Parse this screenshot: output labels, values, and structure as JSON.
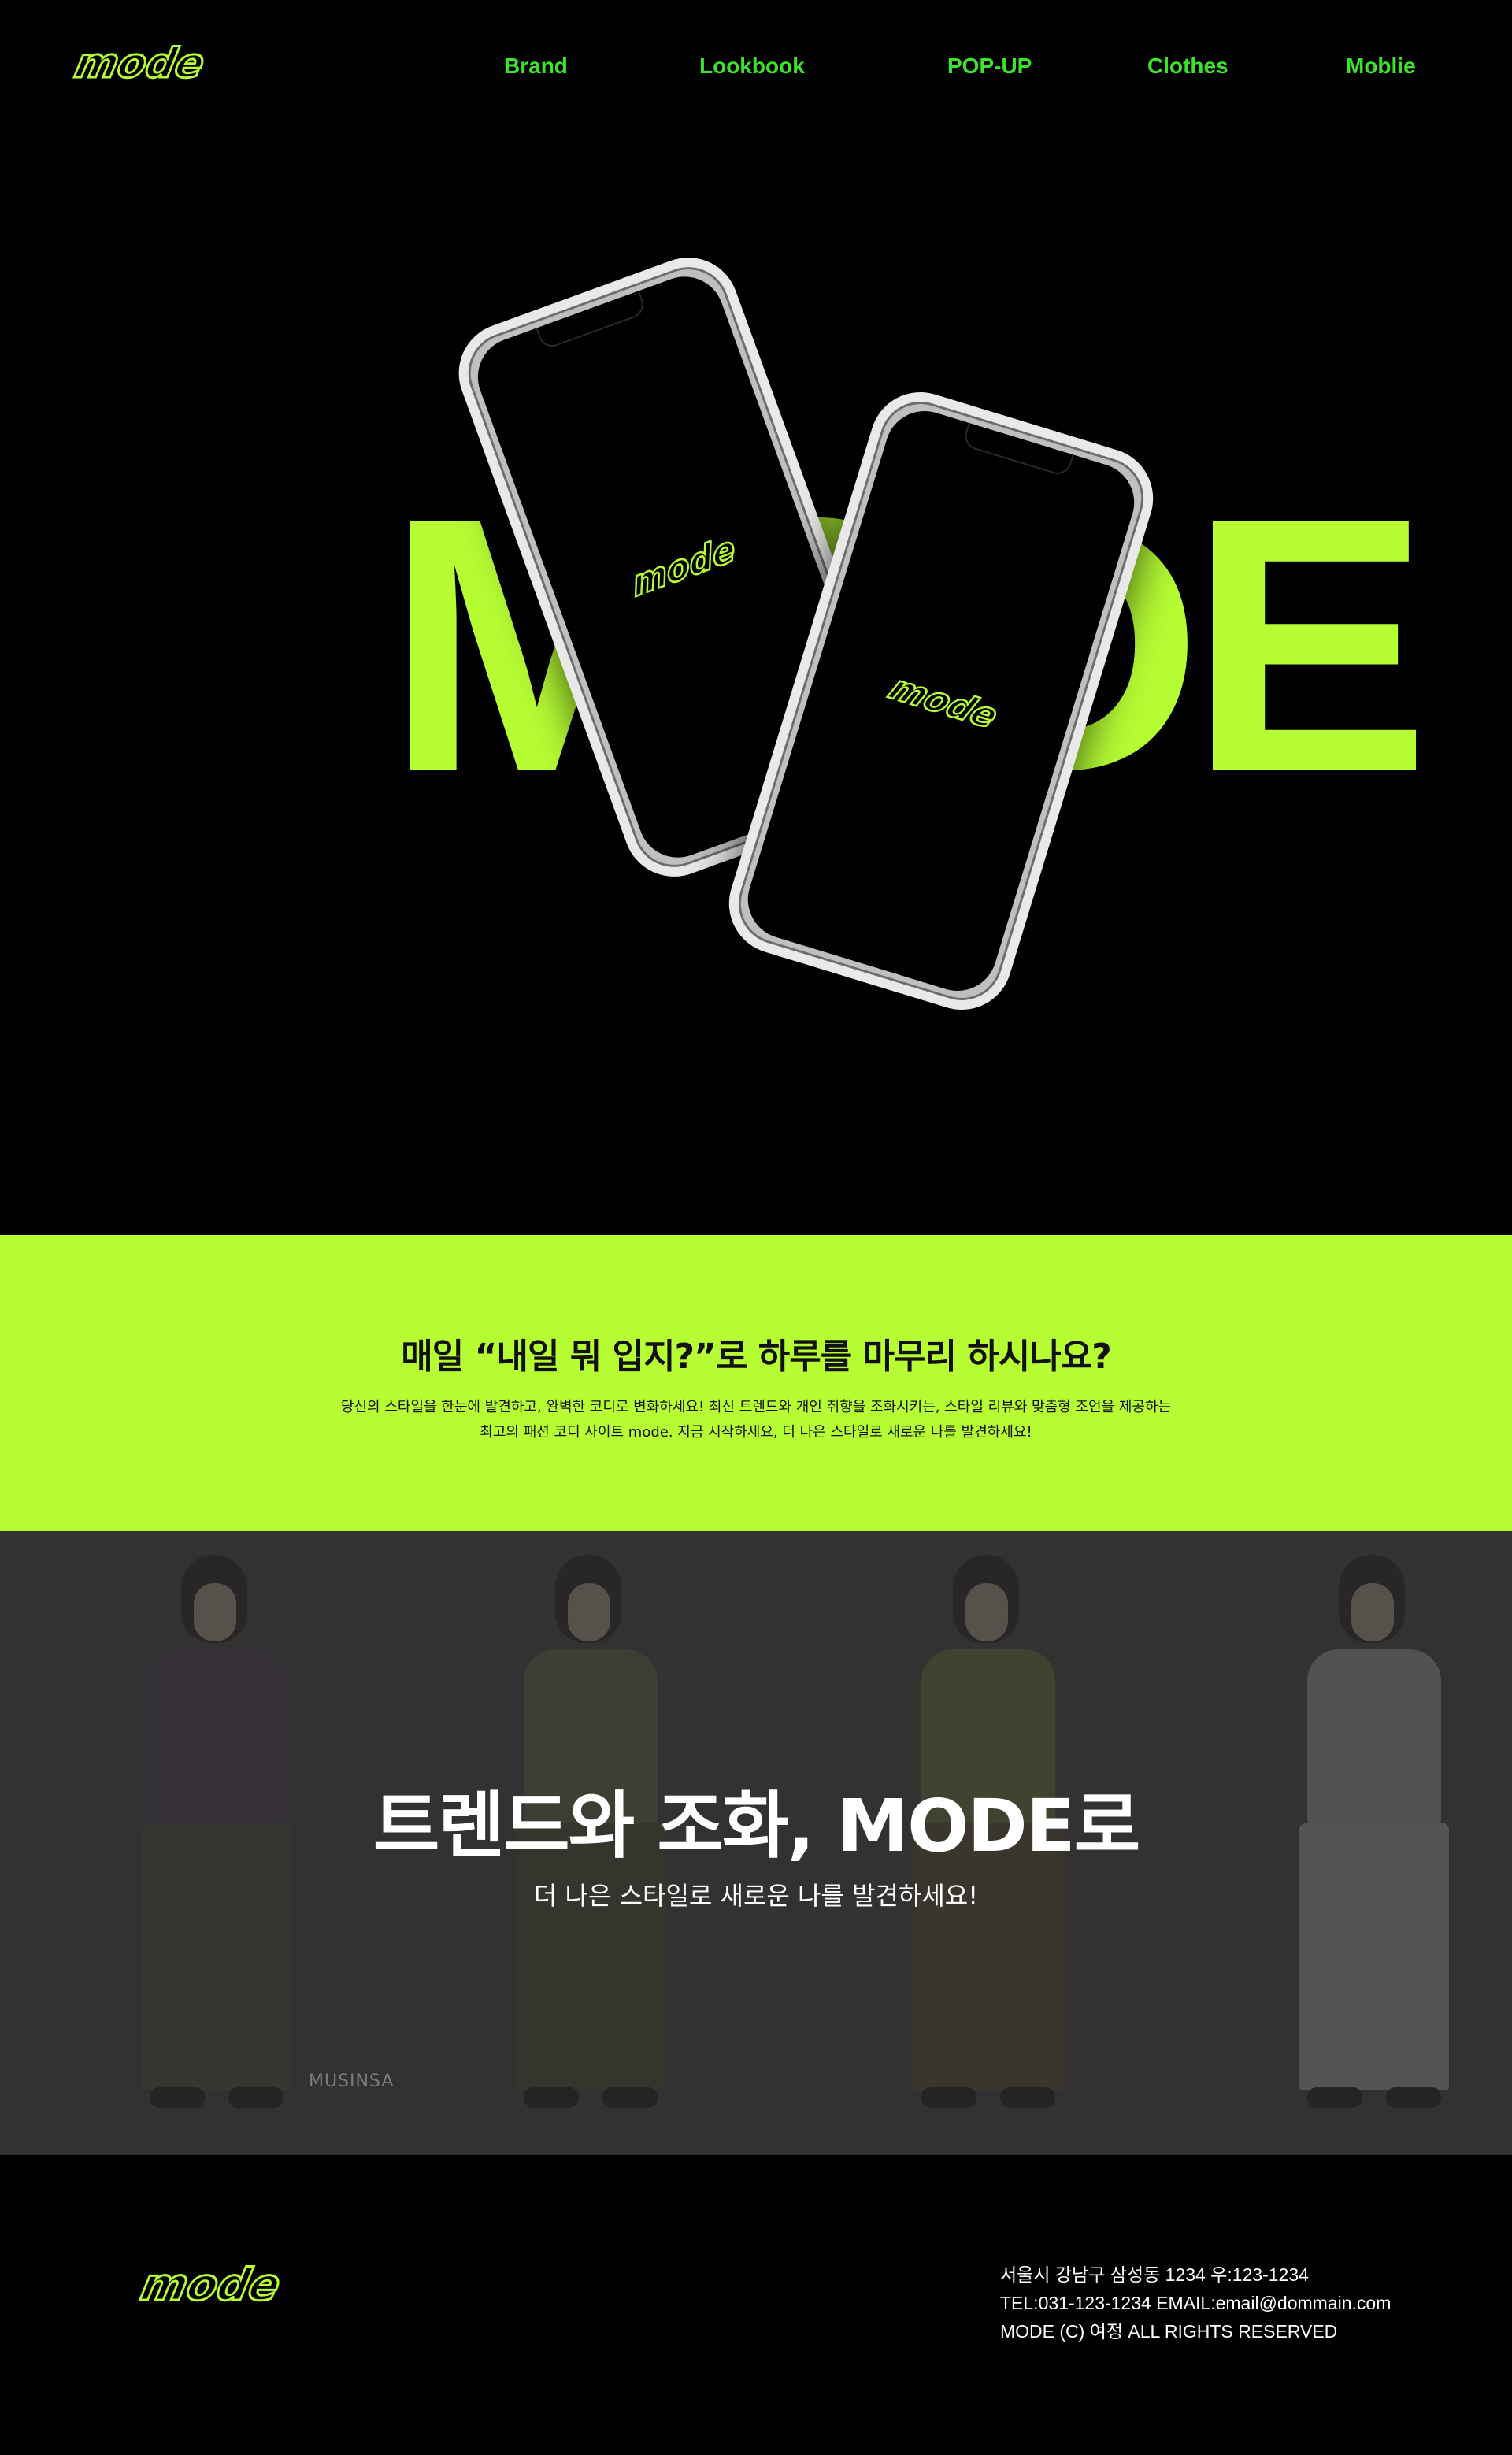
{
  "brand": {
    "logo_text": "mode",
    "accent_color": "#b6fd34",
    "nav_color": "#3de22d"
  },
  "nav": {
    "items": [
      {
        "label": "Brand"
      },
      {
        "label": "Lookbook"
      },
      {
        "label": "POP-UP"
      },
      {
        "label": "Clothes"
      },
      {
        "label": "Moblie"
      }
    ]
  },
  "hero": {
    "word": "MODE",
    "phone_logo": "mode"
  },
  "intro": {
    "title": "매일  “내일 뭐 입지?”로 하루를 마무리 하시나요?",
    "body_line1": "당신의 스타일을 한눈에 발견하고, 완벽한 코디로 변화하세요! 최신 트렌드와 개인 취향을 조화시키는, 스타일 리뷰와 맞춤형 조언을 제공하는",
    "body_line2": "최고의 패션 코디 사이트 mode. 지금 시작하세요, 더 나은 스타일로 새로운 나를 발견하세요!"
  },
  "banner": {
    "title": "트렌드와 조화, MODE로",
    "subtitle": "더 나은 스타일로 새로운 나를 발견하세요!",
    "watermark": "MUSINSA"
  },
  "footer": {
    "logo_text": "mode",
    "address": "서울시 강남구 삼성동 1234 우:123-1234",
    "contact": "TEL:031-123-1234 EMAIL:email@dommain.com",
    "copyright": "MODE (C) 여정 ALL RIGHTS RESERVED"
  }
}
